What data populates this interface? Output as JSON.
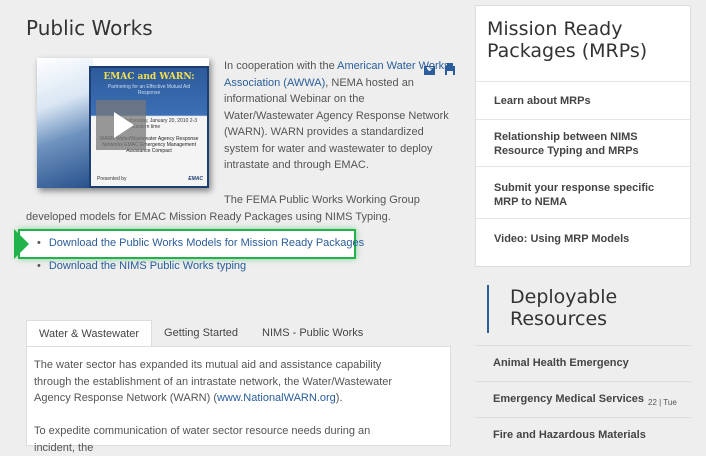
{
  "page_title": "Public Works",
  "video": {
    "slide_title": "EMAC and WARN:",
    "slide_subtitle": "Partnering for an Effective Mutual Aid Response",
    "slide_date": "Wednesday, January 20, 2010 2-3 p.m. Eastern time",
    "slide_warn": "WARN Water/Wastewater Agency Response Networks EMAC Emergency Management Assistance Compact",
    "slide_logo_left": "Presented by",
    "slide_logo_right": "EMAC"
  },
  "intro": {
    "prefix": "In cooperation with the ",
    "link": "American Water Works Association (AWWA)",
    "suffix": ", NEMA hosted an informational Webinar on the Water/Wastewater Agency Response Network (WARN).  WARN provides a standardized system for water and wastewater to deploy intrastate and through EMAC."
  },
  "fema_text": "The FEMA Public Works Working Group developed models for EMAC Mission Ready Packages using NIMS Typing.",
  "links": [
    {
      "bullet": "•",
      "label": "Download the Public Works Models for Mission Ready Packages"
    },
    {
      "bullet": "•",
      "label": "Download the NIMS Public Works typing"
    }
  ],
  "tabs": [
    {
      "label": "Water & Wastewater"
    },
    {
      "label": "Getting Started"
    },
    {
      "label": "NIMS - Public Works"
    }
  ],
  "panel": {
    "p1_text": "The water sector has expanded its mutual aid and assistance capability through the establishment of an intrastate network, the Water/Wastewater Agency Response Network (WARN) (",
    "p1_link": "www.NationalWARN.org",
    "p1_end": ").",
    "p2_text": "To expedite communication of water sector resource needs during an incident, the"
  },
  "mrp": {
    "title": "Mission Ready Packages (MRPs)",
    "items": [
      {
        "label": "Learn about MRPs"
      },
      {
        "label": "Relationship between NIMS Resource Typing and MRPs"
      },
      {
        "label": "Submit your response specific MRP to NEMA"
      },
      {
        "label": "Video: Using MRP Models"
      }
    ]
  },
  "deployable": {
    "title": "Deployable Resources",
    "items": [
      {
        "label": "Animal Health Emergency"
      },
      {
        "label": "Emergency Medical Services"
      },
      {
        "label": "Fire and Hazardous Materials"
      }
    ]
  },
  "time_label": "22 | Tue",
  "colors": {
    "link": "#2a5d9a",
    "highlight": "#21b34a",
    "background": "#eeeeee"
  }
}
